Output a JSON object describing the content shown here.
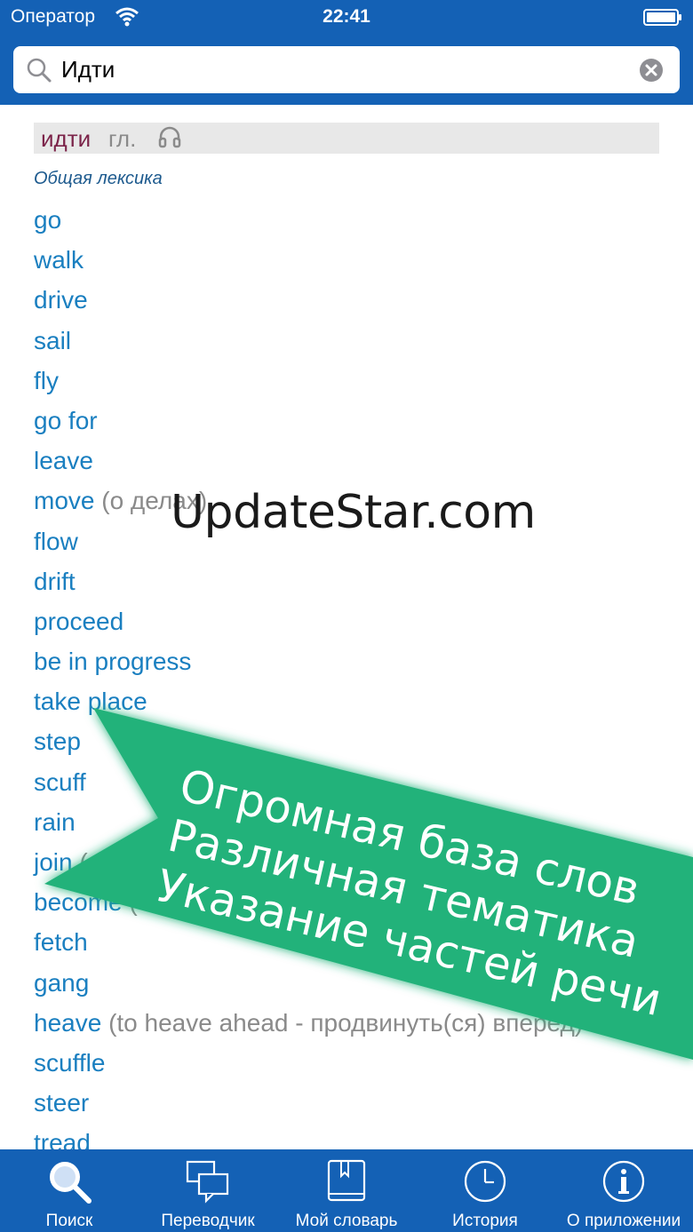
{
  "status_bar": {
    "carrier": "Оператор",
    "time": "22:41"
  },
  "search": {
    "value": "Идти"
  },
  "entry": {
    "headword": "идти",
    "pos": "гл.",
    "section": "Общая лексика",
    "translations": [
      {
        "word": "go",
        "note": ""
      },
      {
        "word": "walk",
        "note": ""
      },
      {
        "word": "drive",
        "note": ""
      },
      {
        "word": "sail",
        "note": ""
      },
      {
        "word": "fly",
        "note": ""
      },
      {
        "word": "go for",
        "note": ""
      },
      {
        "word": "leave",
        "note": ""
      },
      {
        "word": "move",
        "note": "(о делах)"
      },
      {
        "word": "flow",
        "note": ""
      },
      {
        "word": "drift",
        "note": ""
      },
      {
        "word": "proceed",
        "note": ""
      },
      {
        "word": "be in progress",
        "note": ""
      },
      {
        "word": "take place",
        "note": ""
      },
      {
        "word": "step",
        "note": ""
      },
      {
        "word": "scuff",
        "note": ""
      },
      {
        "word": "rain",
        "note": ""
      },
      {
        "word": "join",
        "note": "("
      },
      {
        "word": "become",
        "note": "("
      },
      {
        "word": "fetch",
        "note": ""
      },
      {
        "word": "gang",
        "note": ""
      },
      {
        "word": "heave",
        "note": "(to heave ahead - продвинуть(ся) вперед)"
      },
      {
        "word": "scuffle",
        "note": ""
      },
      {
        "word": "steer",
        "note": ""
      },
      {
        "word": "tread",
        "note": ""
      }
    ]
  },
  "watermark": "UpdateStar.com",
  "promo": {
    "color": "#20b27a",
    "lines": [
      "Огромная база слов",
      "Различная тематика",
      "Указание частей речи"
    ]
  },
  "tabbar": {
    "tabs": [
      {
        "label": "Поиск",
        "icon": "search-icon"
      },
      {
        "label": "Переводчик",
        "icon": "chat-bubbles-icon"
      },
      {
        "label": "Мой словарь",
        "icon": "book-icon"
      },
      {
        "label": "История",
        "icon": "clock-icon"
      },
      {
        "label": "О приложении",
        "icon": "info-icon"
      }
    ]
  },
  "colors": {
    "brand": "#1461b5",
    "link": "#1a7fc0",
    "headword": "#7b2349",
    "banner": "#20b27a"
  }
}
